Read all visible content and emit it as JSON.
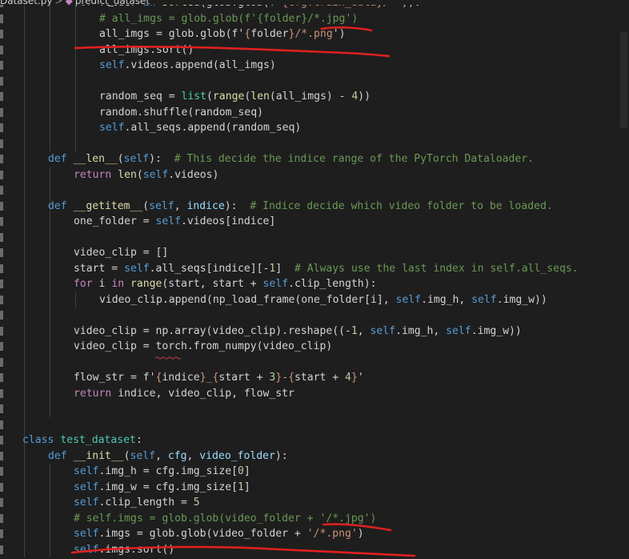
{
  "breadcrumb": {
    "file": "Dataset.py",
    "sep": ">",
    "symbol": "predict_dataset"
  },
  "lines": [
    {
      "indent": 92,
      "tokens": [
        [
          "kw",
          "for "
        ],
        [
          "pl",
          "folder "
        ],
        [
          "kw",
          "in "
        ],
        [
          "fn",
          "sorted"
        ],
        [
          "pl",
          "(glob.glob(f'"
        ],
        [
          "str",
          "{cfg.train_data}/*"
        ],
        [
          "pl",
          "')):"
        ]
      ]
    },
    {
      "indent": 124,
      "tokens": [
        [
          "cm",
          "# all_imgs = glob.glob(f'{folder}/*.jpg')"
        ]
      ]
    },
    {
      "indent": 124,
      "tokens": [
        [
          "pl",
          "all_imgs = glob.glob(f'"
        ],
        [
          "str",
          "{"
        ],
        [
          "pl",
          "folder"
        ],
        [
          "str",
          "}/*.png"
        ],
        [
          "pl",
          "')"
        ]
      ]
    },
    {
      "indent": 124,
      "tokens": [
        [
          "pl",
          "all_imgs.sort()"
        ]
      ]
    },
    {
      "indent": 124,
      "tokens": [
        [
          "kw",
          "self"
        ],
        [
          "pl",
          ".videos.append(all_imgs)"
        ]
      ]
    },
    {
      "indent": 124,
      "tokens": []
    },
    {
      "indent": 124,
      "tokens": [
        [
          "pl",
          "random_seq = "
        ],
        [
          "cls",
          "list"
        ],
        [
          "pl",
          "("
        ],
        [
          "fn",
          "range"
        ],
        [
          "pl",
          "("
        ],
        [
          "fn",
          "len"
        ],
        [
          "pl",
          "(all_imgs) - "
        ],
        [
          "num",
          "4"
        ],
        [
          "pl",
          "))"
        ]
      ]
    },
    {
      "indent": 124,
      "tokens": [
        [
          "pl",
          "random.shuffle(random_seq)"
        ]
      ]
    },
    {
      "indent": 124,
      "tokens": [
        [
          "kw",
          "self"
        ],
        [
          "pl",
          ".all_seqs.append(random_seq)"
        ]
      ]
    },
    {
      "indent": 60,
      "tokens": []
    },
    {
      "indent": 60,
      "tokens": [
        [
          "kw",
          "def "
        ],
        [
          "fn",
          "__len__"
        ],
        [
          "pl",
          "("
        ],
        [
          "kw",
          "self"
        ],
        [
          "pl",
          "):  "
        ],
        [
          "cm",
          "# This decide the indice range of the PyTorch Dataloader."
        ]
      ]
    },
    {
      "indent": 92,
      "tokens": [
        [
          "ctl",
          "return "
        ],
        [
          "fn",
          "len"
        ],
        [
          "pl",
          "("
        ],
        [
          "kw",
          "self"
        ],
        [
          "pl",
          ".videos)"
        ]
      ]
    },
    {
      "indent": 60,
      "tokens": []
    },
    {
      "indent": 60,
      "tokens": [
        [
          "kw",
          "def "
        ],
        [
          "fn",
          "__getitem__"
        ],
        [
          "pl",
          "("
        ],
        [
          "kw",
          "self"
        ],
        [
          "pl",
          ", "
        ],
        [
          "var",
          "indice"
        ],
        [
          "pl",
          "):  "
        ],
        [
          "cm",
          "# Indice decide which video folder to be loaded."
        ]
      ]
    },
    {
      "indent": 92,
      "tokens": [
        [
          "pl",
          "one_folder = "
        ],
        [
          "kw",
          "self"
        ],
        [
          "pl",
          ".videos[indice]"
        ]
      ]
    },
    {
      "indent": 92,
      "tokens": []
    },
    {
      "indent": 92,
      "tokens": [
        [
          "pl",
          "video_clip = []"
        ]
      ]
    },
    {
      "indent": 92,
      "tokens": [
        [
          "pl",
          "start = "
        ],
        [
          "kw",
          "self"
        ],
        [
          "pl",
          ".all_seqs[indice][-"
        ],
        [
          "num",
          "1"
        ],
        [
          "pl",
          "]  "
        ],
        [
          "cm",
          "# Always use the last index in self.all_seqs."
        ]
      ]
    },
    {
      "indent": 92,
      "tokens": [
        [
          "ctl",
          "for "
        ],
        [
          "pl",
          "i "
        ],
        [
          "ctl",
          "in "
        ],
        [
          "fn",
          "range"
        ],
        [
          "pl",
          "(start, start + "
        ],
        [
          "kw",
          "self"
        ],
        [
          "pl",
          ".clip_length):"
        ]
      ]
    },
    {
      "indent": 124,
      "tokens": [
        [
          "pl",
          "video_clip.append(np_load_frame(one_folder[i], "
        ],
        [
          "kw",
          "self"
        ],
        [
          "pl",
          ".img_h, "
        ],
        [
          "kw",
          "self"
        ],
        [
          "pl",
          ".img_w))"
        ]
      ]
    },
    {
      "indent": 92,
      "tokens": []
    },
    {
      "indent": 92,
      "tokens": [
        [
          "pl",
          "video_clip = np.array(video_clip).reshape((-"
        ],
        [
          "num",
          "1"
        ],
        [
          "pl",
          ", "
        ],
        [
          "kw",
          "self"
        ],
        [
          "pl",
          ".img_h, "
        ],
        [
          "kw",
          "self"
        ],
        [
          "pl",
          ".img_w))"
        ]
      ]
    },
    {
      "indent": 92,
      "tokens": [
        [
          "pl",
          "video_clip = torch.from_numpy(video_clip)"
        ]
      ]
    },
    {
      "indent": 92,
      "tokens": []
    },
    {
      "indent": 92,
      "tokens": [
        [
          "pl",
          "flow_str = f'"
        ],
        [
          "str",
          "{"
        ],
        [
          "pl",
          "indice"
        ],
        [
          "str",
          "}_{"
        ],
        [
          "pl",
          "start + "
        ],
        [
          "num",
          "3"
        ],
        [
          "str",
          "}-{"
        ],
        [
          "pl",
          "start + "
        ],
        [
          "num",
          "4"
        ],
        [
          "str",
          "}"
        ],
        [
          "pl",
          "'"
        ]
      ]
    },
    {
      "indent": 92,
      "tokens": [
        [
          "ctl",
          "return "
        ],
        [
          "pl",
          "indice, video_clip, flow_str"
        ]
      ]
    },
    {
      "indent": 28,
      "tokens": []
    },
    {
      "indent": 28,
      "tokens": []
    },
    {
      "indent": 28,
      "tokens": [
        [
          "kw",
          "class "
        ],
        [
          "cls",
          "test_dataset"
        ],
        [
          "pl",
          ":"
        ]
      ]
    },
    {
      "indent": 60,
      "tokens": [
        [
          "kw",
          "def "
        ],
        [
          "fn",
          "__init__"
        ],
        [
          "pl",
          "("
        ],
        [
          "kw",
          "self"
        ],
        [
          "pl",
          ", "
        ],
        [
          "var",
          "cfg"
        ],
        [
          "pl",
          ", "
        ],
        [
          "var",
          "video_folder"
        ],
        [
          "pl",
          "):"
        ]
      ]
    },
    {
      "indent": 92,
      "tokens": [
        [
          "kw",
          "self"
        ],
        [
          "pl",
          ".img_h = cfg.img_size["
        ],
        [
          "num",
          "0"
        ],
        [
          "pl",
          "]"
        ]
      ]
    },
    {
      "indent": 92,
      "tokens": [
        [
          "kw",
          "self"
        ],
        [
          "pl",
          ".img_w = cfg.img_size["
        ],
        [
          "num",
          "1"
        ],
        [
          "pl",
          "]"
        ]
      ]
    },
    {
      "indent": 92,
      "tokens": [
        [
          "kw",
          "self"
        ],
        [
          "pl",
          ".clip_length = "
        ],
        [
          "num",
          "5"
        ]
      ]
    },
    {
      "indent": 92,
      "tokens": [
        [
          "cm",
          "# self.imgs = glob.glob(video_folder + '/*.jpg')"
        ]
      ]
    },
    {
      "indent": 92,
      "tokens": [
        [
          "kw",
          "self"
        ],
        [
          "pl",
          ".imgs = glob.glob(video_folder + "
        ],
        [
          "str",
          "'/*.png'"
        ],
        [
          "pl",
          ")"
        ]
      ]
    },
    {
      "indent": 92,
      "tokens": [
        [
          "kw",
          "self"
        ],
        [
          "pl",
          ".imgs.sort()"
        ]
      ]
    }
  ],
  "colors": {
    "background": "#1e1e1e",
    "annotation_ink": "#e0201e"
  }
}
